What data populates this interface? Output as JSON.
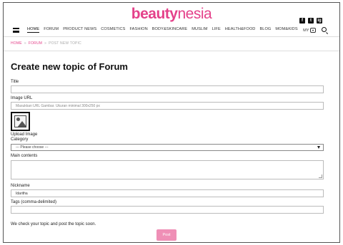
{
  "brand": {
    "logo_bold": "beauty",
    "logo_rest": "nesia",
    "accent": "#e4418a"
  },
  "social": [
    "f",
    "t",
    "ig"
  ],
  "nav": {
    "items": [
      "HOME",
      "FORUM",
      "PRODUCT NEWS",
      "COSMETICS",
      "FASHION",
      "BODY&SKINCARE",
      "MUSLIM",
      "LIFE",
      "HEALTH&FOOD",
      "BLOG",
      "MOM&KIDS"
    ],
    "active": "HOME",
    "my_label": "MY"
  },
  "breadcrumb": {
    "home": "HOME",
    "forum": "FORUM",
    "current": "POST NEW TOPIC"
  },
  "form": {
    "title": "Create new topic of Forum",
    "title_label": "Title",
    "image_url_label": "Image URL",
    "image_url_placeholder": "Masukkan URL Gambar. Ukuran minimal 300x250 px",
    "upload_label": "Upload Image",
    "category_label": "Category",
    "category_selected": "--- Please choose ---",
    "main_label": "Main contents",
    "nickname_label": "Nickname",
    "nickname_value": "Idaritha",
    "tags_label": "Tags (comma-delimited)",
    "note": "We check your topic and post the topic soon.",
    "post_label": "Post"
  }
}
